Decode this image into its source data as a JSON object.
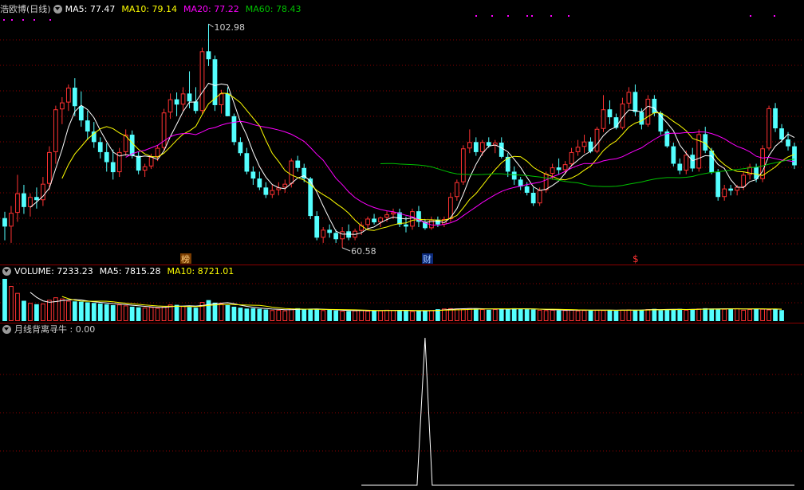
{
  "stock": {
    "name": "浩欧博",
    "period": "(日线)"
  },
  "colors": {
    "up": "#ff3232",
    "down": "#54ffff",
    "ma5": "#ffffff",
    "ma10": "#ffff00",
    "ma20": "#ff00ff",
    "ma60": "#00c000",
    "grid": "#8b0000",
    "dots": "#ff00ff"
  },
  "price_panel": {
    "ma5": {
      "label": "MA5:",
      "value": "77.47"
    },
    "ma10": {
      "label": "MA10:",
      "value": "79.14"
    },
    "ma20": {
      "label": "MA20:",
      "value": "77.22"
    },
    "ma60": {
      "label": "MA60:",
      "value": "78.43"
    },
    "high_label": "102.98",
    "low_label": "60.58",
    "event_markers": [
      "榜",
      "财",
      "$"
    ]
  },
  "volume_panel": {
    "volume": {
      "label": "VOLUME:",
      "value": "7233.23"
    },
    "ma5": {
      "label": "MA5:",
      "value": "7815.28"
    },
    "ma10": {
      "label": "MA10:",
      "value": "8721.01"
    }
  },
  "indicator_panel": {
    "name": "月线背离寻牛",
    "sep": ":",
    "value": "0.00"
  },
  "chart_data": {
    "type": "candlestick",
    "title": "浩欧博(日线)",
    "ylim": [
      60.58,
      102.98
    ],
    "annotations": [
      "102.98",
      "60.58",
      "榜",
      "财",
      "$"
    ],
    "candles": [
      [
        66.2,
        67.4,
        62.0,
        64.6
      ],
      [
        64.6,
        68.5,
        61.5,
        67.2
      ],
      [
        67.2,
        74.4,
        65.5,
        70.9
      ],
      [
        70.9,
        72.5,
        67.0,
        68.3
      ],
      [
        68.3,
        70.9,
        66.5,
        70.2
      ],
      [
        70.2,
        72.0,
        68.0,
        69.6
      ],
      [
        69.6,
        74.0,
        68.5,
        72.7
      ],
      [
        72.7,
        79.8,
        71.5,
        78.7
      ],
      [
        78.7,
        87.5,
        76.5,
        86.8
      ],
      [
        86.8,
        89.1,
        84.0,
        88.1
      ],
      [
        88.1,
        91.5,
        86.5,
        90.9
      ],
      [
        90.9,
        92.7,
        85.5,
        87.4
      ],
      [
        87.4,
        90.2,
        83.5,
        84.7
      ],
      [
        84.7,
        86.5,
        81.0,
        82.6
      ],
      [
        82.6,
        84.4,
        79.5,
        80.6
      ],
      [
        80.6,
        81.5,
        77.5,
        78.7
      ],
      [
        78.7,
        80.4,
        75.0,
        76.8
      ],
      [
        76.8,
        79.2,
        73.5,
        74.9
      ],
      [
        74.9,
        79.5,
        74.0,
        78.7
      ],
      [
        78.7,
        83.0,
        78.0,
        82.0
      ],
      [
        82.0,
        82.8,
        77.5,
        78.0
      ],
      [
        78.0,
        78.8,
        74.5,
        75.2
      ],
      [
        75.2,
        76.5,
        74.0,
        76.0
      ],
      [
        76.0,
        78.4,
        75.5,
        77.8
      ],
      [
        77.8,
        80.0,
        77.0,
        79.5
      ],
      [
        79.5,
        86.9,
        79.0,
        86.2
      ],
      [
        86.2,
        89.8,
        85.0,
        88.7
      ],
      [
        88.7,
        90.0,
        85.5,
        87.7
      ],
      [
        87.7,
        91.0,
        86.5,
        89.8
      ],
      [
        89.8,
        94.0,
        87.0,
        88.3
      ],
      [
        88.3,
        91.0,
        86.0,
        86.5
      ],
      [
        86.5,
        98.5,
        86.0,
        97.8
      ],
      [
        97.8,
        102.98,
        95.0,
        96.3
      ],
      [
        96.3,
        97.0,
        86.5,
        87.6
      ],
      [
        87.6,
        90.5,
        86.0,
        89.8
      ],
      [
        89.8,
        91.0,
        85.5,
        85.5
      ],
      [
        85.5,
        86.0,
        80.0,
        80.6
      ],
      [
        80.6,
        81.5,
        78.0,
        78.5
      ],
      [
        78.5,
        79.5,
        74.5,
        75.0
      ],
      [
        75.0,
        76.0,
        72.5,
        73.7
      ],
      [
        73.7,
        75.0,
        71.5,
        72.0
      ],
      [
        72.0,
        73.0,
        70.0,
        70.6
      ],
      [
        70.6,
        72.5,
        70.0,
        71.5
      ],
      [
        71.5,
        73.0,
        70.5,
        72.0
      ],
      [
        72.0,
        73.5,
        71.0,
        72.7
      ],
      [
        72.7,
        77.5,
        72.0,
        77.1
      ],
      [
        77.1,
        78.0,
        75.0,
        75.7
      ],
      [
        75.7,
        76.5,
        73.0,
        73.7
      ],
      [
        73.7,
        74.0,
        66.0,
        66.6
      ],
      [
        66.6,
        67.5,
        62.0,
        62.5
      ],
      [
        62.5,
        64.5,
        61.5,
        64.0
      ],
      [
        64.0,
        65.0,
        62.5,
        63.4
      ],
      [
        63.4,
        64.0,
        61.5,
        62.2
      ],
      [
        62.2,
        64.5,
        60.58,
        63.7
      ],
      [
        63.7,
        65.0,
        62.0,
        62.5
      ],
      [
        62.5,
        64.2,
        62.0,
        63.8
      ],
      [
        63.8,
        65.5,
        63.0,
        64.9
      ],
      [
        64.9,
        66.5,
        64.0,
        66.1
      ],
      [
        66.1,
        67.0,
        65.0,
        65.4
      ],
      [
        65.4,
        66.5,
        64.5,
        66.3
      ],
      [
        66.3,
        67.5,
        65.5,
        66.9
      ],
      [
        66.9,
        68.0,
        66.0,
        67.3
      ],
      [
        67.3,
        68.0,
        64.5,
        65.0
      ],
      [
        65.0,
        66.5,
        63.5,
        64.6
      ],
      [
        64.6,
        68.0,
        64.0,
        67.5
      ],
      [
        67.5,
        68.5,
        64.5,
        65.5
      ],
      [
        65.5,
        66.0,
        64.0,
        64.3
      ],
      [
        64.3,
        66.5,
        64.0,
        65.9
      ],
      [
        65.9,
        66.5,
        64.5,
        65.0
      ],
      [
        65.0,
        66.5,
        64.5,
        66.0
      ],
      [
        66.0,
        71.0,
        65.5,
        70.2
      ],
      [
        70.2,
        73.5,
        69.5,
        73.0
      ],
      [
        73.0,
        80.0,
        72.5,
        79.4
      ],
      [
        79.4,
        83.0,
        78.5,
        80.6
      ],
      [
        80.6,
        81.5,
        78.0,
        78.7
      ],
      [
        78.7,
        81.0,
        78.0,
        80.6
      ],
      [
        80.6,
        81.5,
        79.5,
        79.9
      ],
      [
        79.9,
        81.0,
        78.5,
        80.5
      ],
      [
        80.5,
        81.5,
        77.5,
        77.8
      ],
      [
        77.8,
        78.5,
        74.0,
        75.0
      ],
      [
        75.0,
        76.0,
        72.5,
        73.5
      ],
      [
        73.5,
        74.0,
        71.5,
        72.2
      ],
      [
        72.2,
        73.0,
        70.5,
        71.0
      ],
      [
        71.0,
        72.0,
        68.5,
        69.0
      ],
      [
        69.0,
        72.0,
        68.5,
        71.5
      ],
      [
        71.5,
        75.0,
        71.0,
        74.6
      ],
      [
        74.6,
        76.5,
        73.5,
        75.8
      ],
      [
        75.8,
        77.5,
        74.5,
        75.3
      ],
      [
        75.3,
        77.0,
        74.5,
        76.4
      ],
      [
        76.4,
        79.5,
        76.0,
        78.7
      ],
      [
        78.7,
        81.0,
        78.0,
        79.7
      ],
      [
        79.7,
        82.0,
        78.5,
        80.7
      ],
      [
        80.7,
        81.5,
        78.5,
        78.8
      ],
      [
        78.8,
        83.5,
        78.5,
        83.1
      ],
      [
        83.1,
        89.5,
        82.5,
        86.8
      ],
      [
        86.8,
        88.5,
        84.0,
        85.3
      ],
      [
        85.3,
        86.0,
        83.0,
        83.3
      ],
      [
        83.3,
        89.0,
        83.0,
        87.9
      ],
      [
        87.9,
        91.0,
        87.0,
        90.1
      ],
      [
        90.1,
        91.5,
        85.5,
        86.3
      ],
      [
        86.3,
        87.0,
        83.0,
        83.9
      ],
      [
        83.9,
        89.5,
        83.5,
        88.8
      ],
      [
        88.8,
        89.5,
        85.5,
        86.1
      ],
      [
        86.1,
        86.5,
        82.0,
        82.6
      ],
      [
        82.6,
        83.0,
        79.5,
        79.8
      ],
      [
        79.8,
        80.5,
        76.0,
        76.5
      ],
      [
        76.5,
        77.5,
        74.5,
        75.2
      ],
      [
        75.2,
        79.0,
        74.5,
        78.2
      ],
      [
        78.2,
        79.5,
        75.0,
        75.6
      ],
      [
        75.6,
        83.0,
        75.0,
        82.1
      ],
      [
        82.1,
        83.5,
        78.5,
        79.0
      ],
      [
        79.0,
        79.5,
        74.5,
        74.9
      ],
      [
        74.9,
        75.5,
        69.5,
        70.2
      ],
      [
        70.2,
        72.5,
        69.5,
        71.8
      ],
      [
        71.8,
        72.5,
        70.5,
        71.4
      ],
      [
        71.4,
        72.5,
        70.5,
        72.1
      ],
      [
        72.1,
        75.0,
        71.5,
        74.4
      ],
      [
        74.4,
        76.5,
        73.5,
        75.9
      ],
      [
        75.9,
        76.5,
        73.0,
        73.6
      ],
      [
        73.6,
        80.0,
        73.0,
        79.4
      ],
      [
        79.4,
        87.5,
        79.0,
        87.0
      ],
      [
        87.0,
        88.0,
        82.5,
        83.2
      ],
      [
        83.2,
        84.0,
        80.5,
        81.1
      ],
      [
        81.1,
        82.5,
        79.0,
        79.8
      ],
      [
        79.8,
        80.5,
        75.5,
        76.2
      ]
    ],
    "volume": [
      13500,
      11200,
      9000,
      6500,
      5800,
      5400,
      5600,
      6800,
      7600,
      7200,
      6500,
      6300,
      6200,
      6000,
      5800,
      5600,
      5400,
      5100,
      5300,
      5000,
      4600,
      4400,
      4300,
      4500,
      4200,
      4600,
      5300,
      5200,
      4800,
      4500,
      4300,
      6100,
      6700,
      5900,
      5600,
      5100,
      4600,
      4300,
      4000,
      4100,
      3900,
      3700,
      3500,
      3600,
      3400,
      4000,
      4100,
      3900,
      3800,
      3700,
      3500,
      3600,
      3400,
      3300,
      3200,
      3400,
      3500,
      3300,
      3300,
      3400,
      3600,
      3500,
      3400,
      3300,
      3200,
      3200,
      3300,
      3500,
      3800,
      4000,
      4100,
      4000,
      3900,
      4100,
      4000,
      3800,
      3600,
      3800,
      4000,
      3900,
      4100,
      3900,
      3800,
      3700,
      3600,
      3500,
      3600,
      3400,
      3500,
      3600,
      3400,
      3500,
      3400,
      3600,
      3500,
      3500,
      3300,
      3600,
      3700,
      3500,
      3600,
      3800,
      3900,
      3500,
      3800,
      3700,
      3900,
      3600,
      3700,
      4000,
      4100,
      4000,
      3800,
      3900,
      4000,
      4100,
      3600,
      3800,
      4000,
      3900,
      3700,
      3800,
      3500
    ],
    "indicator": {
      "name": "月线背离寻牛",
      "value": "0.00"
    }
  }
}
